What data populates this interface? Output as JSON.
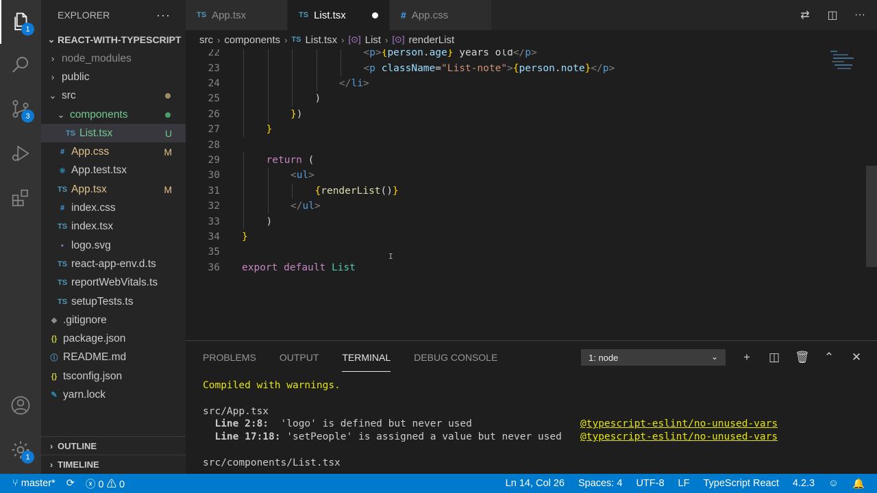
{
  "activity_bar": {
    "explorer_badge": "1",
    "scm_badge": "3",
    "settings_badge": "1"
  },
  "sidebar": {
    "title": "EXPLORER",
    "more": "···",
    "project": "REACT-WITH-TYPESCRIPT",
    "tree": [
      {
        "label": "node_modules",
        "type": "folder",
        "depth": 1,
        "state": "collapsed",
        "color": "gray"
      },
      {
        "label": "public",
        "type": "folder",
        "depth": 1,
        "state": "collapsed"
      },
      {
        "label": "src",
        "type": "folder",
        "depth": 1,
        "state": "expanded",
        "dot": "#a08d63"
      },
      {
        "label": "components",
        "type": "folder",
        "depth": 2,
        "state": "expanded",
        "color": "green",
        "dot": "#4b9c6a"
      },
      {
        "label": "List.tsx",
        "type": "ts",
        "icon": "TS",
        "depth": 3,
        "color": "green",
        "status": "U",
        "selected": true
      },
      {
        "label": "App.css",
        "type": "css",
        "icon": "#",
        "depth": 2,
        "color": "yellow",
        "status": "M"
      },
      {
        "label": "App.test.tsx",
        "type": "test",
        "icon": "⚛",
        "depth": 2
      },
      {
        "label": "App.tsx",
        "type": "ts",
        "icon": "TS",
        "depth": 2,
        "color": "yellow",
        "status": "M"
      },
      {
        "label": "index.css",
        "type": "css",
        "icon": "#",
        "depth": 2
      },
      {
        "label": "index.tsx",
        "type": "ts",
        "icon": "TS",
        "depth": 2
      },
      {
        "label": "logo.svg",
        "type": "svg",
        "icon": "▪",
        "depth": 2
      },
      {
        "label": "react-app-env.d.ts",
        "type": "ts",
        "icon": "TS",
        "depth": 2
      },
      {
        "label": "reportWebVitals.ts",
        "type": "ts",
        "icon": "TS",
        "depth": 2
      },
      {
        "label": "setupTests.ts",
        "type": "ts",
        "icon": "TS",
        "depth": 2
      },
      {
        "label": ".gitignore",
        "type": "git",
        "icon": "◆",
        "depth": 1
      },
      {
        "label": "package.json",
        "type": "json",
        "icon": "{}",
        "depth": 1
      },
      {
        "label": "README.md",
        "type": "md",
        "icon": "ⓘ",
        "depth": 1
      },
      {
        "label": "tsconfig.json",
        "type": "json",
        "icon": "{}",
        "depth": 1
      },
      {
        "label": "yarn.lock",
        "type": "yarn",
        "icon": "✎",
        "depth": 1
      }
    ],
    "outline": "OUTLINE",
    "timeline": "TIMELINE"
  },
  "tabs": [
    {
      "icon": "TS",
      "label": "App.tsx",
      "active": false
    },
    {
      "icon": "TS",
      "label": "List.tsx",
      "active": true,
      "modified": true
    },
    {
      "icon": "#",
      "label": "App.css",
      "active": false
    }
  ],
  "breadcrumb": {
    "parts": [
      "src",
      "components"
    ],
    "file_icon": "TS",
    "file": "List.tsx",
    "symbol1": "List",
    "symbol2": "renderList"
  },
  "editor": {
    "lines": [
      {
        "n": "22",
        "indent": 5,
        "tokens": [
          [
            "k-gray",
            "<"
          ],
          [
            "k-tag",
            "p"
          ],
          [
            "k-gray",
            ">"
          ],
          [
            "k-br",
            "{"
          ],
          [
            "k-var",
            "person"
          ],
          [
            "",
            "."
          ],
          [
            "k-var",
            "age"
          ],
          [
            "k-br",
            "}"
          ],
          [
            "",
            " years old"
          ],
          [
            "k-gray",
            "</"
          ],
          [
            "k-tag",
            "p"
          ],
          [
            "k-gray",
            ">"
          ]
        ]
      },
      {
        "n": "23",
        "indent": 5,
        "tokens": [
          [
            "k-gray",
            "<"
          ],
          [
            "k-tag",
            "p"
          ],
          [
            "",
            " "
          ],
          [
            "k-attr",
            "className"
          ],
          [
            "",
            "="
          ],
          [
            "k-str",
            "\"List-note\""
          ],
          [
            "k-gray",
            ">"
          ],
          [
            "k-br",
            "{"
          ],
          [
            "k-var",
            "person"
          ],
          [
            "",
            "."
          ],
          [
            "k-var",
            "note"
          ],
          [
            "k-br",
            "}"
          ],
          [
            "k-gray",
            "</"
          ],
          [
            "k-tag",
            "p"
          ],
          [
            "k-gray",
            ">"
          ]
        ]
      },
      {
        "n": "24",
        "indent": 4,
        "tokens": [
          [
            "k-gray",
            "</"
          ],
          [
            "k-tag",
            "li"
          ],
          [
            "k-gray",
            ">"
          ]
        ]
      },
      {
        "n": "25",
        "indent": 3,
        "tokens": [
          [
            "",
            ")"
          ]
        ]
      },
      {
        "n": "26",
        "indent": 2,
        "tokens": [
          [
            "k-br",
            "}"
          ],
          [
            "",
            ")"
          ]
        ]
      },
      {
        "n": "27",
        "indent": 1,
        "tokens": [
          [
            "k-br",
            "}"
          ]
        ]
      },
      {
        "n": "28",
        "indent": 0,
        "tokens": []
      },
      {
        "n": "29",
        "indent": 1,
        "tokens": [
          [
            "k-purple",
            "return"
          ],
          [
            "",
            " ("
          ]
        ]
      },
      {
        "n": "30",
        "indent": 2,
        "tokens": [
          [
            "k-gray",
            "<"
          ],
          [
            "k-tag",
            "ul"
          ],
          [
            "k-gray",
            ">"
          ]
        ]
      },
      {
        "n": "31",
        "indent": 3,
        "tokens": [
          [
            "k-br",
            "{"
          ],
          [
            "k-fn",
            "renderList"
          ],
          [
            "",
            "()"
          ],
          [
            "k-br",
            "}"
          ]
        ]
      },
      {
        "n": "32",
        "indent": 2,
        "tokens": [
          [
            "k-gray",
            "</"
          ],
          [
            "k-tag",
            "ul"
          ],
          [
            "k-gray",
            ">"
          ]
        ]
      },
      {
        "n": "33",
        "indent": 1,
        "tokens": [
          [
            "",
            ")"
          ]
        ]
      },
      {
        "n": "34",
        "indent": 0,
        "tokens": [
          [
            "k-br",
            "}"
          ]
        ]
      },
      {
        "n": "35",
        "indent": 0,
        "tokens": []
      },
      {
        "n": "36",
        "indent": 0,
        "tokens": [
          [
            "k-purple",
            "export"
          ],
          [
            "",
            " "
          ],
          [
            "k-purple",
            "default"
          ],
          [
            "",
            " "
          ],
          [
            "k-class",
            "List"
          ]
        ]
      }
    ]
  },
  "panel": {
    "tabs": [
      "PROBLEMS",
      "OUTPUT",
      "TERMINAL",
      "DEBUG CONSOLE"
    ],
    "active_tab": "TERMINAL",
    "terminal_select": "1: node",
    "terminal": {
      "compiled": "Compiled with warnings.",
      "file1": "src/App.tsx",
      "warnings": [
        {
          "loc": "Line 2:8:",
          "msg": "  'logo' is defined but never used",
          "rule": "@typescript-eslint/no-unused-vars"
        },
        {
          "loc": "Line 17:18:",
          "msg": " 'setPeople' is assigned a value but never used",
          "rule": "@typescript-eslint/no-unused-vars"
        }
      ],
      "file2": "src/components/List.tsx"
    }
  },
  "statusbar": {
    "branch": "master*",
    "errors": "0",
    "warnings": "0",
    "position": "Ln 14, Col 26",
    "spaces": "Spaces: 4",
    "encoding": "UTF-8",
    "eol": "LF",
    "language": "TypeScript React",
    "version": "4.2.3"
  }
}
